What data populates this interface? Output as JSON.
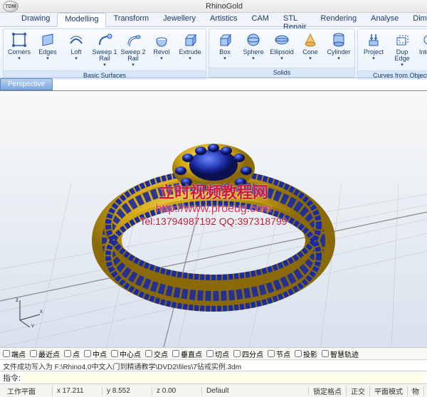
{
  "app": {
    "title": "RhinoGold",
    "logo": "TDM"
  },
  "menu": {
    "items": [
      "Drawing",
      "Modelling",
      "Transform",
      "Jewellery",
      "Artistics",
      "CAM",
      "STL Repair",
      "Rendering",
      "Analyse",
      "Dimension"
    ],
    "active": "Modelling"
  },
  "ribbon": {
    "groups": [
      {
        "label": "Basic Surfaces",
        "buttons": [
          {
            "label": "Corners",
            "icon": "corners"
          },
          {
            "label": "Edges",
            "icon": "edges"
          },
          {
            "label": "Loft",
            "icon": "loft"
          },
          {
            "label": "Sweep 1\nRail",
            "icon": "sweep1"
          },
          {
            "label": "Sweep 2\nRail",
            "icon": "sweep2"
          },
          {
            "label": "Revol",
            "icon": "revolve"
          },
          {
            "label": "Extrude",
            "icon": "extrude"
          }
        ]
      },
      {
        "label": "Solids",
        "buttons": [
          {
            "label": "Box",
            "icon": "box"
          },
          {
            "label": "Sphere",
            "icon": "sphere"
          },
          {
            "label": "Ellipsoid",
            "icon": "ellipsoid"
          },
          {
            "label": "Cone",
            "icon": "cone"
          },
          {
            "label": "Cylinder",
            "icon": "cylinder"
          }
        ]
      },
      {
        "label": "Curves from Objects",
        "buttons": [
          {
            "label": "Project",
            "icon": "project"
          },
          {
            "label": "Dup Edge",
            "icon": "dupedge"
          },
          {
            "label": "Intersec",
            "icon": "intersect"
          }
        ]
      }
    ]
  },
  "viewport": {
    "active_tab": "Perspective"
  },
  "watermark": {
    "line1": "立时视频教程网",
    "line2": "http://www.proeug.com",
    "line3": "Tel:13794987192    QQ:397318799"
  },
  "snaps": [
    "端点",
    "最近点",
    "点",
    "中点",
    "中心点",
    "交点",
    "垂直点",
    "切点",
    "四分点",
    "节点",
    "投影",
    "智慧轨迹"
  ],
  "log": {
    "message": "文件成功写入为 F:\\Rhino4.0中文入门到精通教学\\DVD2\\files\\7钻戒实例.3dm"
  },
  "command": {
    "prompt": "指令:",
    "value": ""
  },
  "status": {
    "label_workplane": "工作平面",
    "x": "x 17.211",
    "y": "y 8.552",
    "z": "z 0.00",
    "layer": "Default",
    "gridlock": "锁定格点",
    "ortho": "正交",
    "planar": "平面模式",
    "snap": "物"
  }
}
